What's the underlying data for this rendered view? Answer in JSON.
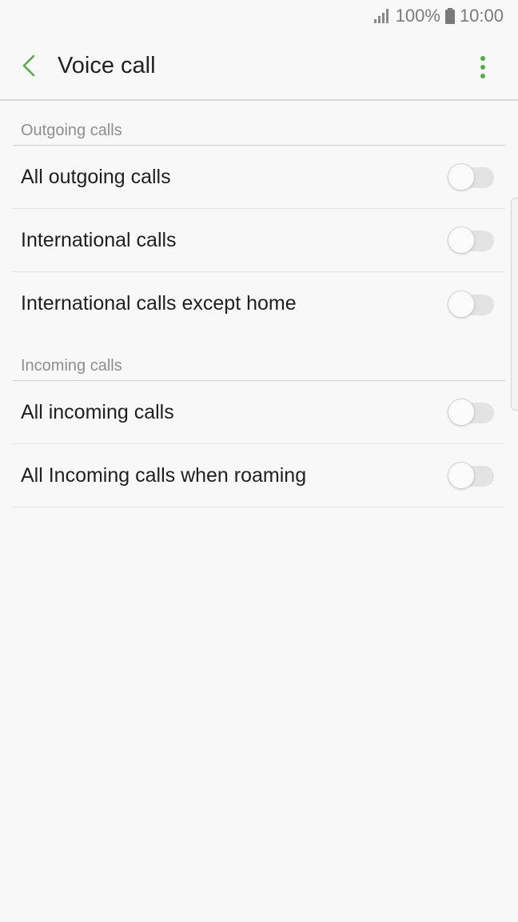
{
  "status_bar": {
    "battery_percent": "100%",
    "time": "10:00",
    "icons": [
      "signal-icon",
      "battery-icon"
    ]
  },
  "header": {
    "title": "Voice call",
    "back_icon": "chevron-left-icon",
    "more_icon": "more-vertical-icon",
    "accent_color": "#5aa64f"
  },
  "sections": [
    {
      "title": "Outgoing calls",
      "items": [
        {
          "label": "All outgoing calls",
          "enabled": false
        },
        {
          "label": "International calls",
          "enabled": false
        },
        {
          "label": "International calls except home",
          "enabled": false
        }
      ]
    },
    {
      "title": "Incoming calls",
      "items": [
        {
          "label": "All incoming calls",
          "enabled": false
        },
        {
          "label": "All Incoming calls when roaming",
          "enabled": false
        }
      ]
    }
  ]
}
